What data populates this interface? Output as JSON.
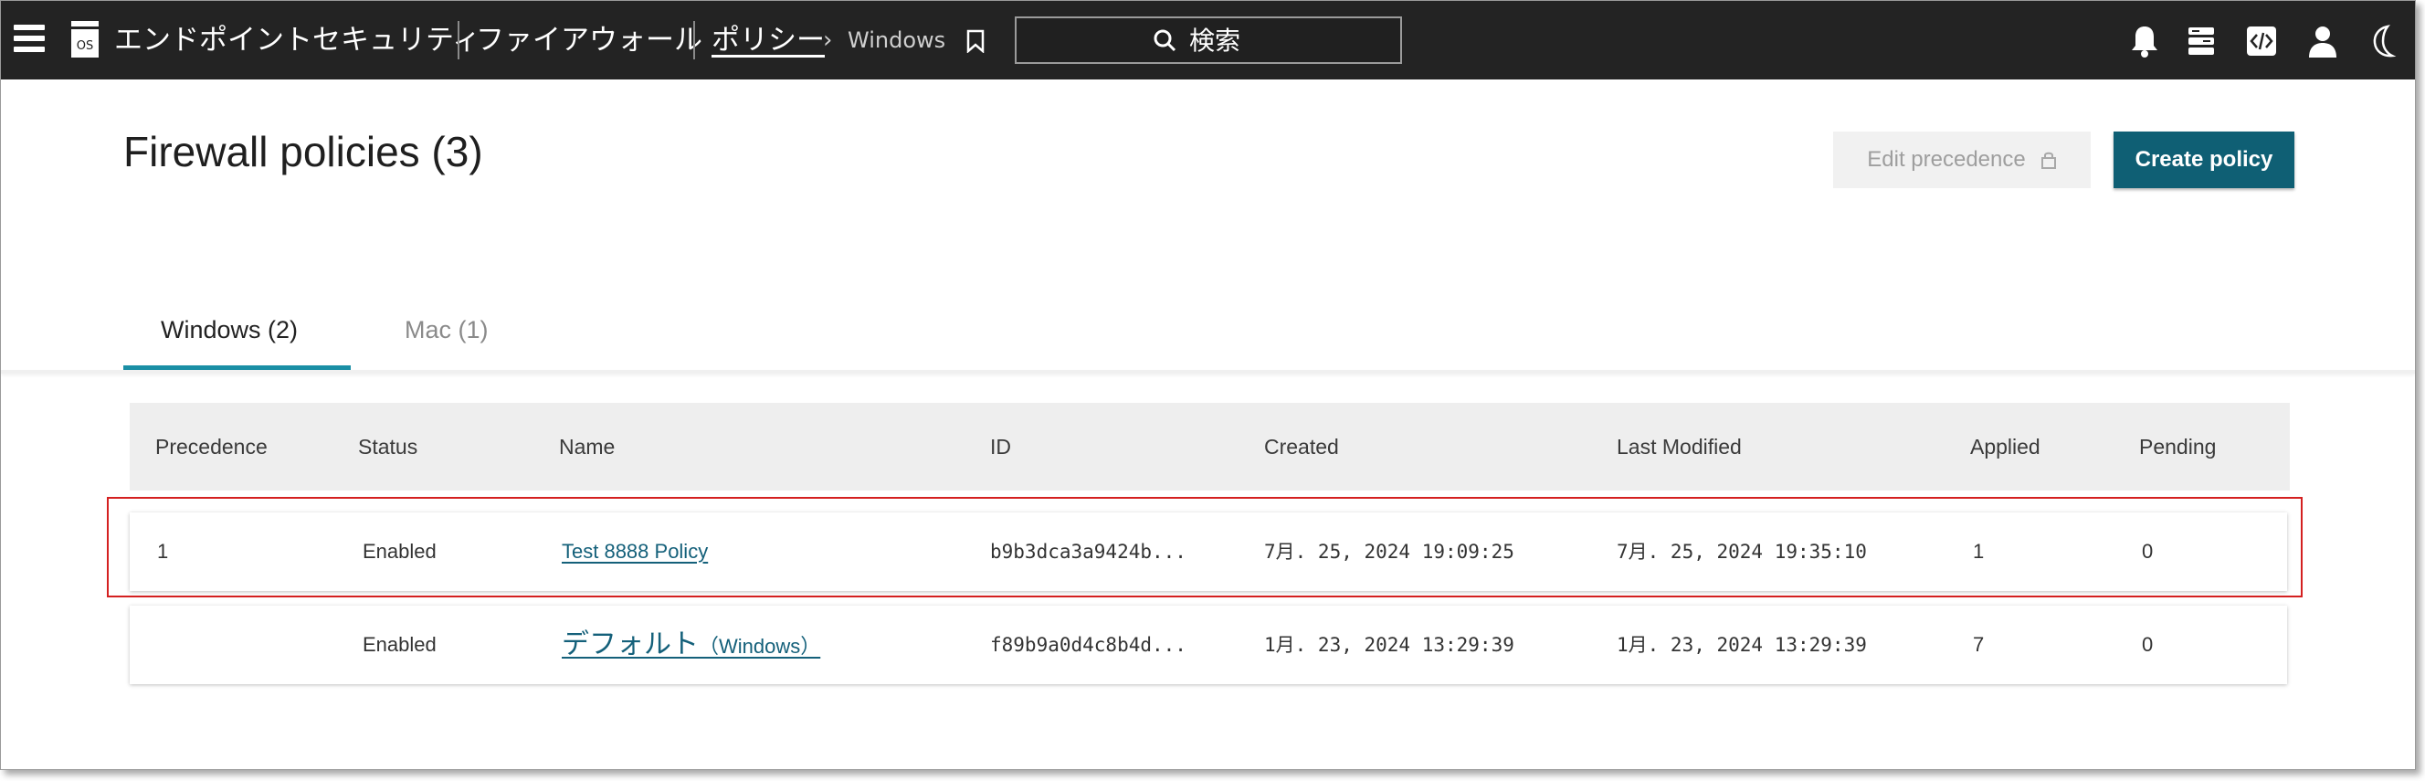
{
  "topbar": {
    "app_title": "エンドポイントセキュリティ",
    "breadcrumb_1": "ファイアウォール",
    "breadcrumb_2": "ポリシー",
    "breadcrumb_sep": "›",
    "breadcrumb_3": "Windows",
    "search_placeholder": "検索",
    "icons": [
      "menu-icon",
      "app-icon",
      "bookmark-icon",
      "search-icon",
      "bell-icon",
      "stack-icon",
      "code-icon",
      "user-icon",
      "moon-icon"
    ]
  },
  "page": {
    "title": "Firewall policies (3)",
    "edit_precedence_label": "Edit precedence",
    "create_policy_label": "Create policy"
  },
  "tabs": [
    {
      "label": "Windows (2)",
      "active": true
    },
    {
      "label": "Mac (1)",
      "active": false
    }
  ],
  "table": {
    "columns": [
      "Precedence",
      "Status",
      "Name",
      "ID",
      "Created",
      "Last Modified",
      "Applied",
      "Pending"
    ],
    "rows": [
      {
        "precedence": "1",
        "status": "Enabled",
        "name": "Test 8888 Policy",
        "id": "b9b3dca3a9424b...",
        "created": "7月. 25, 2024 19:09:25",
        "modified": "7月. 25, 2024 19:35:10",
        "applied": "1",
        "pending": "0"
      },
      {
        "precedence": "",
        "status": "Enabled",
        "name_main": "デフォルト",
        "name_paren": "（Windows）",
        "id": "f89b9a0d4c8b4d...",
        "created": "1月. 23, 2024 13:29:39",
        "modified": "1月. 23, 2024 13:29:39",
        "applied": "7",
        "pending": "0"
      }
    ]
  },
  "colors": {
    "topbar": "#232323",
    "primary": "#0f5f74",
    "accent": "#1a8fa5",
    "highlight": "#d42020"
  }
}
